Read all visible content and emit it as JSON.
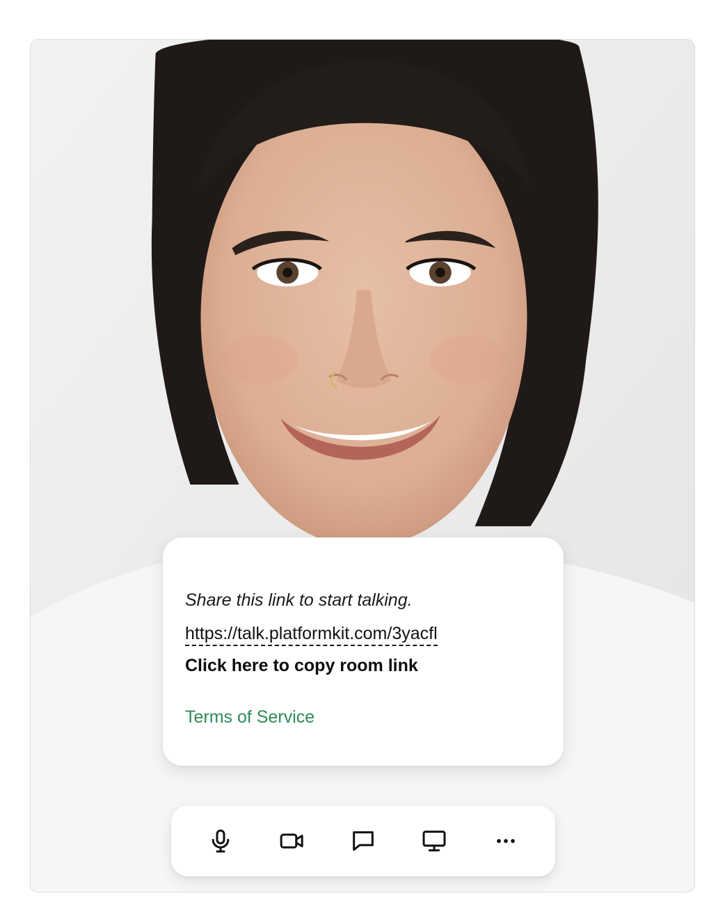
{
  "share_card": {
    "prompt": "Share this link to start talking.",
    "room_url": "https://talk.platformkit.com/3yacfl",
    "copy_label": "Click here to copy room link",
    "terms_label": "Terms of Service"
  },
  "toolbar": {
    "buttons": [
      {
        "icon": "microphone-icon",
        "name": "mic-button"
      },
      {
        "icon": "video-camera-icon",
        "name": "camera-button"
      },
      {
        "icon": "chat-icon",
        "name": "chat-button"
      },
      {
        "icon": "screen-share-icon",
        "name": "screen-share-button"
      },
      {
        "icon": "more-options-icon",
        "name": "more-button"
      }
    ]
  },
  "colors": {
    "link_green": "#2e8a55",
    "text_dark": "#111111",
    "card_bg": "#ffffff",
    "video_bg": "#ebebeb"
  }
}
